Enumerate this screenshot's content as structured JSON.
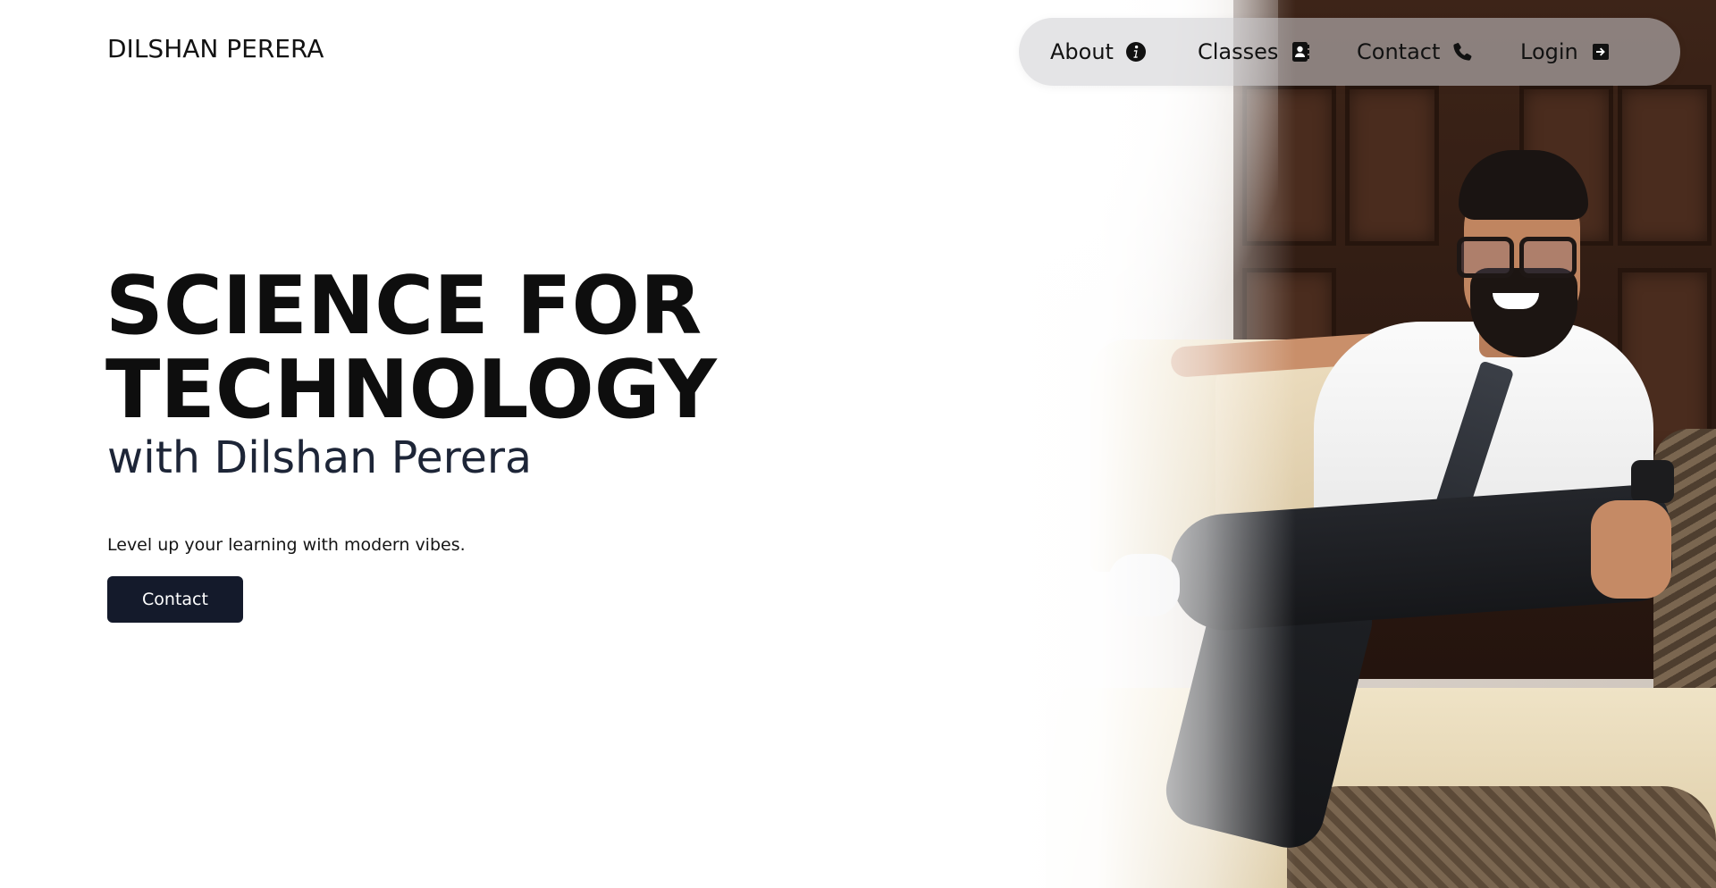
{
  "brand": {
    "name": "DILSHAN PERERA"
  },
  "nav": {
    "items": [
      {
        "label": "About",
        "icon": "info-icon"
      },
      {
        "label": "Classes",
        "icon": "contact-book-icon"
      },
      {
        "label": "Contact",
        "icon": "phone-icon"
      },
      {
        "label": "Login",
        "icon": "sign-in-icon"
      }
    ]
  },
  "hero": {
    "title_line1": "SCIENCE FOR",
    "title_line2": "TECHNOLOGY",
    "subtitle": "with Dilshan Perera",
    "tagline": "Level up your learning with modern vibes.",
    "cta_label": "Contact",
    "photo_subject": "instructor-portrait"
  },
  "colors": {
    "button_bg": "#141a2b",
    "subtitle": "#1d2537",
    "nav_pill": "rgba(205,205,210,0.55)"
  }
}
